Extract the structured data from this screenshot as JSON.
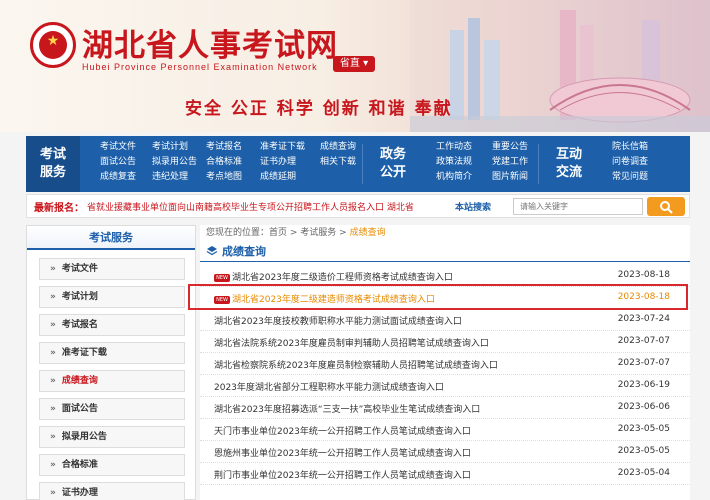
{
  "header": {
    "title": "湖北省人事考试网",
    "subtitle": "Hubei Province Personnel Examination Network",
    "region": "省直",
    "slogan": "安全 公正 科学 创新 和谐 奉献"
  },
  "nav": {
    "exam_service": {
      "label_1": "考试",
      "label_2": "服务",
      "links": [
        "考试文件",
        "考试计划",
        "考试报名",
        "准考证下载",
        "成绩查询",
        "面试公告",
        "拟录用公告",
        "合格标准",
        "证书办理",
        "相关下载",
        "成绩复查",
        "违纪处理",
        "考点地图",
        "成绩延期"
      ]
    },
    "gov_affairs": {
      "label_1": "政务",
      "label_2": "公开",
      "links": [
        "工作动态",
        "重要公告",
        "政策法规",
        "党建工作",
        "机构简介",
        "图片新闻"
      ]
    },
    "interaction": {
      "label_1": "互动",
      "label_2": "交流",
      "links": [
        "院长信箱",
        "问卷调查",
        "常见问题"
      ]
    }
  },
  "notice": {
    "label": "最新报名：",
    "text": "省就业援藏事业单位面向山南籍高校毕业生专项公开招聘工作人员报名入口    湖北省",
    "search_label": "本站搜索",
    "search_placeholder": "请输入关键字"
  },
  "sidebar": {
    "title": "考试服务",
    "items": [
      {
        "label": "考试文件"
      },
      {
        "label": "考试计划"
      },
      {
        "label": "考试报名"
      },
      {
        "label": "准考证下载"
      },
      {
        "label": "成绩查询"
      },
      {
        "label": "面试公告"
      },
      {
        "label": "拟录用公告"
      },
      {
        "label": "合格标准"
      },
      {
        "label": "证书办理"
      }
    ],
    "active_index": 4
  },
  "main": {
    "breadcrumb": {
      "prefix": "您现在的位置：",
      "home": "首页",
      "parent": "考试服务",
      "current": "成绩查询",
      "sep": " > "
    },
    "section_title": "成绩查询",
    "rows": [
      {
        "title": "湖北省2023年度二级造价工程师资格考试成绩查询入口",
        "date": "2023-08-18",
        "new": true
      },
      {
        "title": "湖北省2023年度二级建造师资格考试成绩查询入口",
        "date": "2023-08-18",
        "new": true
      },
      {
        "title": "湖北省2023年度技校教师职称水平能力测试面试成绩查询入口",
        "date": "2023-07-24",
        "new": false
      },
      {
        "title": "湖北省法院系统2023年度雇员制审判辅助人员招聘笔试成绩查询入口",
        "date": "2023-07-07",
        "new": false
      },
      {
        "title": "湖北省检察院系统2023年度雇员制检察辅助人员招聘笔试成绩查询入口",
        "date": "2023-07-07",
        "new": false
      },
      {
        "title": "2023年度湖北省部分工程职称水平能力测试成绩查询入口",
        "date": "2023-06-19",
        "new": false
      },
      {
        "title": "湖北省2023年度招募选派“三支一扶”高校毕业生笔试成绩查询入口",
        "date": "2023-06-06",
        "new": false
      },
      {
        "title": "天门市事业单位2023年统一公开招聘工作人员笔试成绩查询入口",
        "date": "2023-05-05",
        "new": false
      },
      {
        "title": "恩施州事业单位2023年统一公开招聘工作人员笔试成绩查询入口",
        "date": "2023-05-05",
        "new": false
      },
      {
        "title": "荆门市事业单位2023年统一公开招聘工作人员笔试成绩查询入口",
        "date": "2023-05-04",
        "new": false
      }
    ],
    "new_badge": "NEW"
  }
}
